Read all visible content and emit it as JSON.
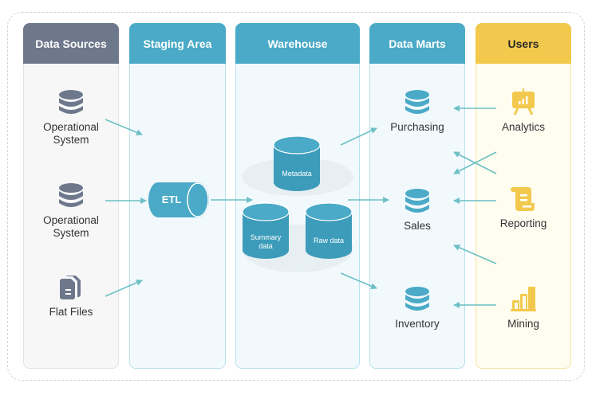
{
  "columns": [
    {
      "title": "Data Sources"
    },
    {
      "title": "Staging Area"
    },
    {
      "title": "Warehouse"
    },
    {
      "title": "Data Marts"
    },
    {
      "title": "Users"
    }
  ],
  "sources": [
    {
      "label": "Operational System",
      "icon": "database-icon"
    },
    {
      "label": "Operational System",
      "icon": "database-icon"
    },
    {
      "label": "Flat Files",
      "icon": "files-icon"
    }
  ],
  "staging": {
    "etl_label": "ETL"
  },
  "warehouse": {
    "metadata": "Metadata",
    "summary": "Summary data",
    "raw": "Raw data"
  },
  "marts": [
    {
      "label": "Purchasing",
      "icon": "database-icon"
    },
    {
      "label": "Sales",
      "icon": "database-icon"
    },
    {
      "label": "Inventory",
      "icon": "database-icon"
    }
  ],
  "users": [
    {
      "label": "Analytics",
      "icon": "presentation-chart-icon"
    },
    {
      "label": "Reporting",
      "icon": "scroll-icon"
    },
    {
      "label": "Mining",
      "icon": "bar-chart-icon"
    }
  ],
  "colors": {
    "sources_header": "#6e788c",
    "teal": "#4aaac7",
    "users_header": "#f2c94c",
    "arrow": "#6cc0c4",
    "icon_gray": "#6e788c",
    "icon_yellow": "#f2c94c"
  }
}
